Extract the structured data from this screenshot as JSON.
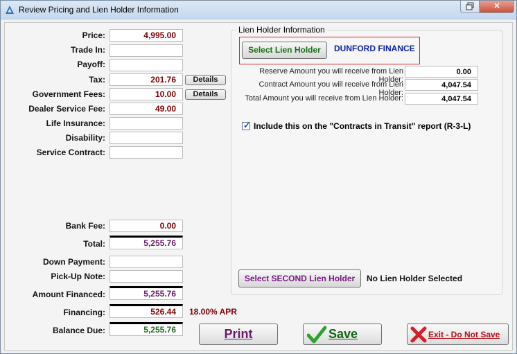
{
  "window": {
    "title": "Review Pricing and Lien Holder Information"
  },
  "pricing": {
    "price": {
      "label": "Price:",
      "value": "4,995.00"
    },
    "trade_in": {
      "label": "Trade In:",
      "value": ""
    },
    "payoff": {
      "label": "Payoff:",
      "value": ""
    },
    "tax": {
      "label": "Tax:",
      "value": "201.76",
      "details": "Details"
    },
    "government_fees": {
      "label": "Government Fees:",
      "value": "10.00",
      "details": "Details"
    },
    "dealer_service_fee": {
      "label": "Dealer Service Fee:",
      "value": "49.00"
    },
    "life_insurance": {
      "label": "Life Insurance:",
      "value": ""
    },
    "disability": {
      "label": "Disability:",
      "value": ""
    },
    "service_contract": {
      "label": "Service Contract:",
      "value": ""
    },
    "bank_fee": {
      "label": "Bank Fee:",
      "value": "0.00"
    },
    "total": {
      "label": "Total:",
      "value": "5,255.76"
    },
    "down_payment": {
      "label": "Down Payment:",
      "value": ""
    },
    "pickup_note": {
      "label": "Pick-Up Note:",
      "value": ""
    },
    "amount_financed": {
      "label": "Amount Financed:",
      "value": "5,255.76"
    },
    "financing": {
      "label": "Financing:",
      "value": "526.44",
      "apr": "18.00% APR"
    },
    "balance_due": {
      "label": "Balance Due:",
      "value": "5,255.76"
    }
  },
  "lien": {
    "group_title": "Lien Holder Information",
    "select_button": "Select Lien Holder",
    "holder_name": "DUNFORD FINANCE",
    "reserve": {
      "label": "Reserve Amount you will receive from Lien Holder:",
      "value": "0.00"
    },
    "contract": {
      "label": "Contract Amount you will receive from Lien Holder:",
      "value": "4,047.54"
    },
    "total": {
      "label": "Total Amount you will receive from Lien Holder:",
      "value": "4,047.54"
    },
    "include_checkbox": {
      "label": "Include this on the \"Contracts in Transit\" report (R-3-L)",
      "checked": true
    },
    "second_button": "Select SECOND Lien Holder",
    "second_status": "No Lien Holder Selected"
  },
  "buttons": {
    "print": "Print",
    "save": "Save",
    "exit": "Exit - Do Not Save"
  },
  "colors": {
    "maroon_value": "#800000",
    "purple_value": "#6a1a6a",
    "green_value": "#1f6b1f",
    "lien_name": "#0b1fa8",
    "highlight_border": "#d9252a"
  }
}
